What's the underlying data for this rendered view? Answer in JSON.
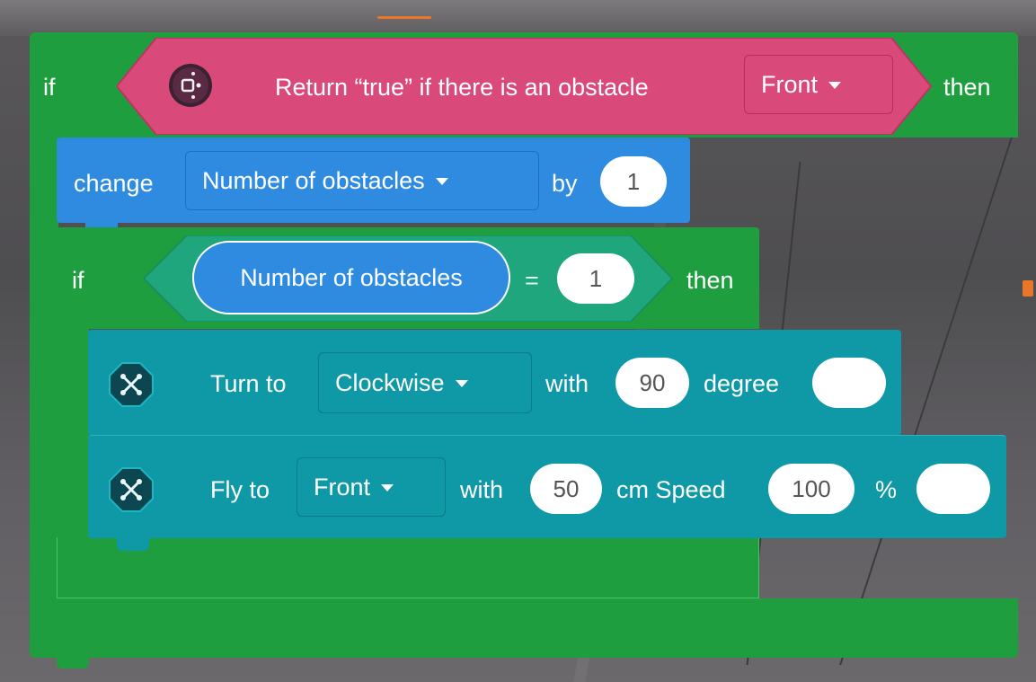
{
  "outer_if": {
    "if_label": "if",
    "then_label": "then",
    "condition": {
      "text": "Return “true” if there is an obstacle",
      "direction": "Front",
      "icon": "sensor-icon"
    }
  },
  "change_block": {
    "label": "change",
    "variable": "Number of obstacles",
    "by_label": "by",
    "value": "1"
  },
  "inner_if": {
    "if_label": "if",
    "then_label": "then",
    "variable": "Number of obstacles",
    "operator": "=",
    "value": "1"
  },
  "turn_block": {
    "label": "Turn to",
    "direction": "Clockwise",
    "with_label": "with",
    "degrees": "90",
    "unit_label": "degree",
    "extra": "",
    "icon": "drone-icon"
  },
  "fly_block": {
    "label": "Fly to",
    "direction": "Front",
    "with_label": "with",
    "distance": "50",
    "unit_label": "cm Speed",
    "speed": "100",
    "percent_label": "%",
    "extra": "",
    "icon": "drone-icon"
  },
  "colors": {
    "control_green": "#1f9e3f",
    "sensor_pink": "#d9497a",
    "variable_blue": "#2e8be0",
    "operator_teal": "#20a67c",
    "motion_teal": "#0f98a6"
  }
}
